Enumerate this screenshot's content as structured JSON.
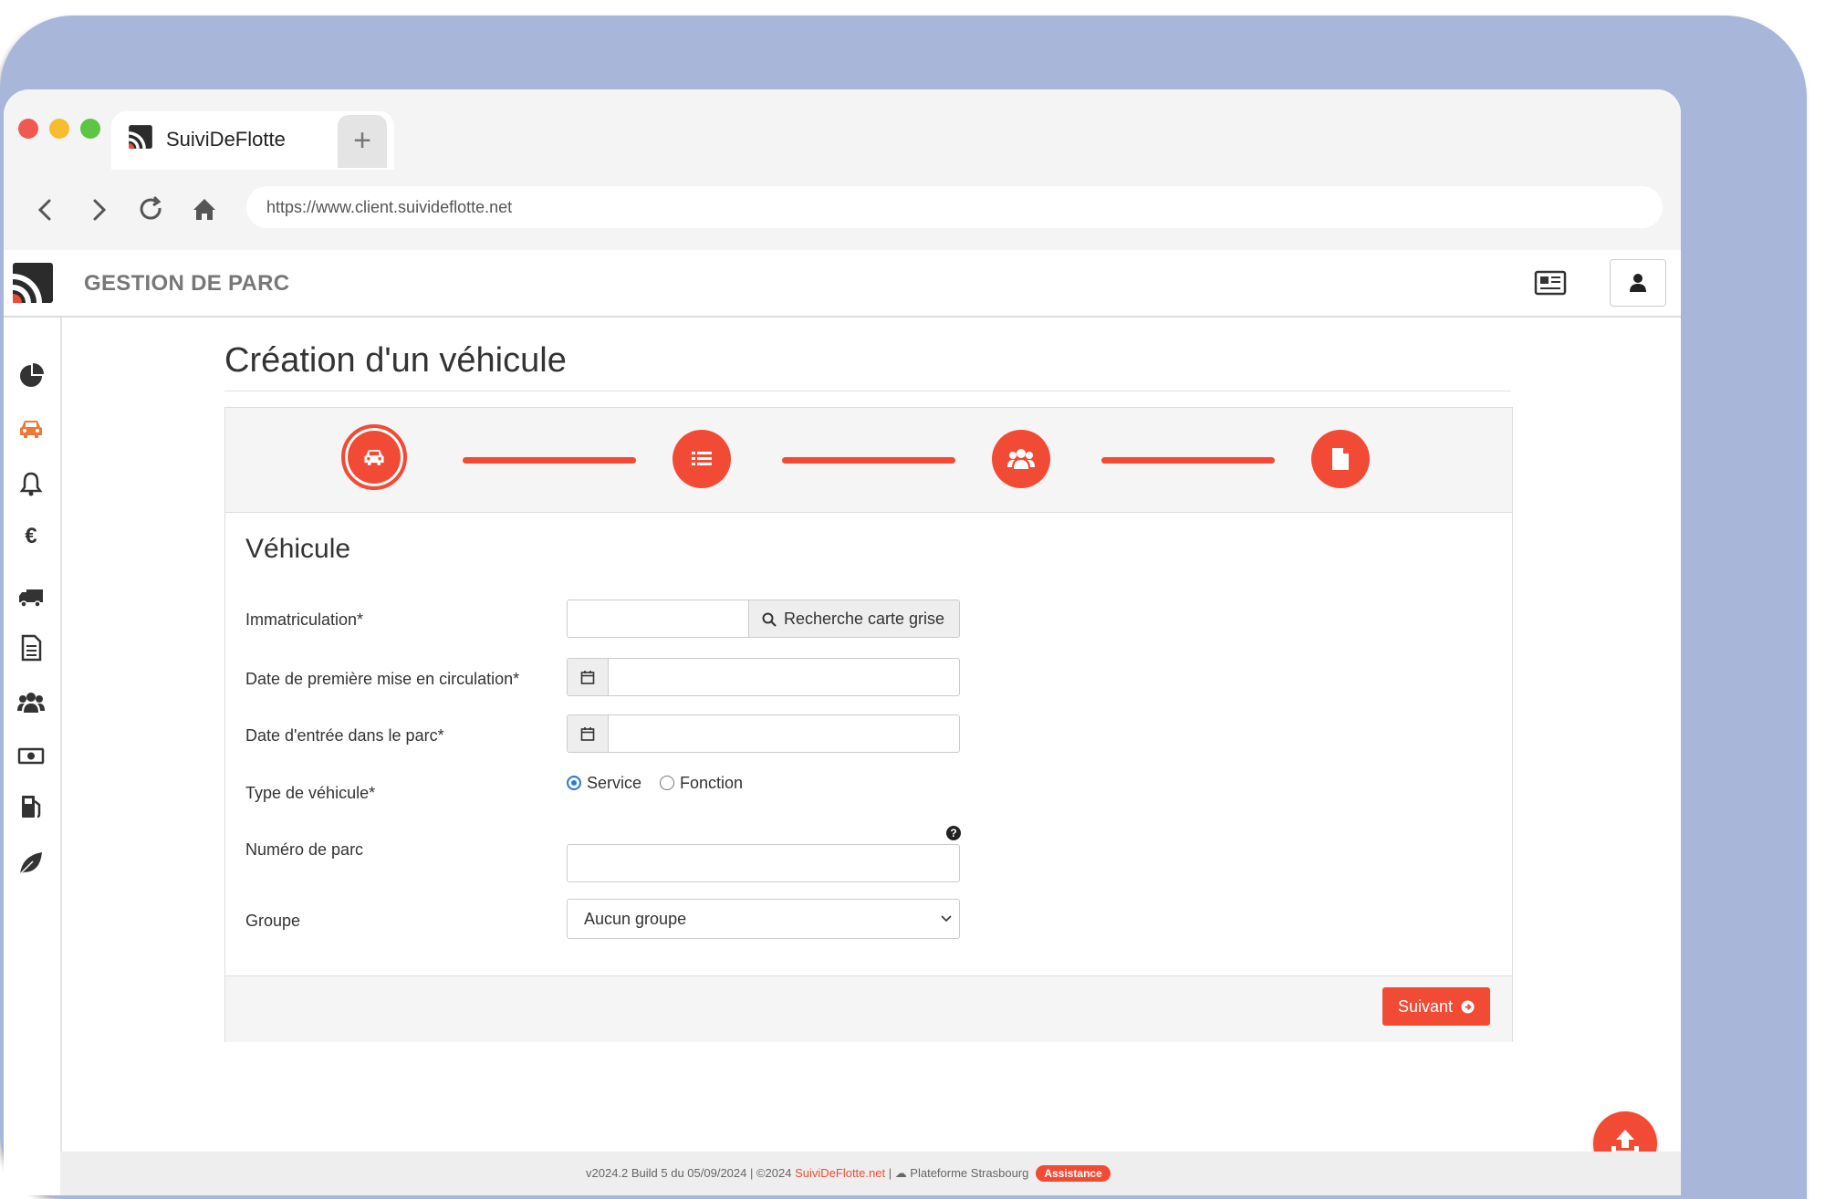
{
  "browser": {
    "tab_title": "SuiviDeFlotte",
    "new_tab_label": "+",
    "url": "https://www.client.suivideflotte.net",
    "nav_icons": [
      "back-icon",
      "forward-icon",
      "reload-icon",
      "home-icon"
    ]
  },
  "app": {
    "title": "GESTION DE PARC",
    "header_icons": [
      "newspaper-icon",
      "user-icon"
    ]
  },
  "sidebar": {
    "items": [
      {
        "icon": "pie-chart-icon",
        "active": false
      },
      {
        "icon": "car-icon",
        "active": true
      },
      {
        "icon": "bell-icon",
        "active": false
      },
      {
        "icon": "euro-icon",
        "active": false
      },
      {
        "icon": "truck-icon",
        "active": false
      },
      {
        "icon": "document-icon",
        "active": false
      },
      {
        "icon": "users-icon",
        "active": false
      },
      {
        "icon": "money-icon",
        "active": false
      },
      {
        "icon": "fuel-icon",
        "active": false
      },
      {
        "icon": "leaf-icon",
        "active": false
      }
    ]
  },
  "page": {
    "title": "Création d'un véhicule"
  },
  "wizard": {
    "steps": [
      {
        "icon": "car-icon",
        "active": true
      },
      {
        "icon": "list-icon",
        "active": false
      },
      {
        "icon": "users-icon",
        "active": false
      },
      {
        "icon": "file-icon",
        "active": false
      }
    ],
    "accent": "#f24b35"
  },
  "form": {
    "section_title": "Véhicule",
    "immatriculation": {
      "label": "Immatriculation*",
      "value": "",
      "search_button": "Recherche carte grise"
    },
    "date_mise_circulation": {
      "label": "Date de première mise en circulation*",
      "value": ""
    },
    "date_entree_parc": {
      "label": "Date d'entrée dans le parc*",
      "value": ""
    },
    "type_vehicule": {
      "label": "Type de véhicule*",
      "options": [
        "Service",
        "Fonction"
      ],
      "selected": "Service"
    },
    "numero_parc": {
      "label": "Numéro de parc",
      "value": ""
    },
    "groupe": {
      "label": "Groupe",
      "selected": "Aucun groupe"
    },
    "next_button": "Suivant"
  },
  "footer": {
    "version": "v2024.2 Build 5 du 05/09/2024 | ©2024 ",
    "brand": "SuiviDeFlotte.net",
    "platform": " | ☁ Plateforme Strasbourg",
    "assistance": "Assistance"
  }
}
